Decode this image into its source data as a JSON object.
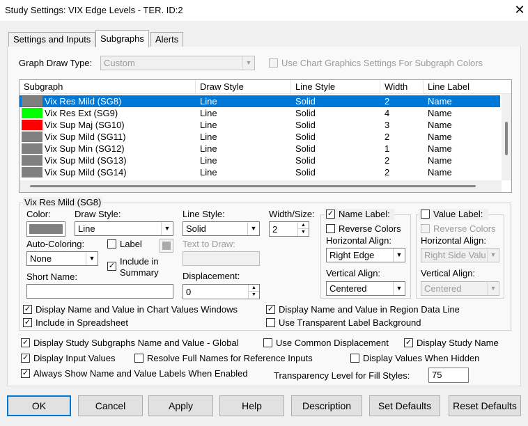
{
  "window": {
    "title": "Study Settings: VIX Edge Levels - TER. ID:2",
    "close_glyph": "✕"
  },
  "tabs": [
    {
      "label": "Settings and Inputs"
    },
    {
      "label": "Subgraphs"
    },
    {
      "label": "Alerts"
    }
  ],
  "graph_draw_type": {
    "label": "Graph Draw Type:",
    "value": "Custom"
  },
  "use_chart_graphics": {
    "label": "Use Chart Graphics Settings For Subgraph Colors",
    "checked": false
  },
  "subgraph_list": {
    "columns": [
      "Subgraph",
      "Draw Style",
      "Line Style",
      "Width",
      "Line Label"
    ],
    "rows": [
      {
        "name": "Vix Res Mild (SG8)",
        "draw_style": "Line",
        "line_style": "Solid",
        "width": "2",
        "line_label": "Name",
        "color": "#7f7f7f",
        "selected": true
      },
      {
        "name": "Vix Res Ext (SG9)",
        "draw_style": "Line",
        "line_style": "Solid",
        "width": "4",
        "line_label": "Name",
        "color": "#00ff00"
      },
      {
        "name": "Vix Sup Maj (SG10)",
        "draw_style": "Line",
        "line_style": "Solid",
        "width": "3",
        "line_label": "Name",
        "color": "#ff0000"
      },
      {
        "name": "Vix Sup Mild (SG11)",
        "draw_style": "Line",
        "line_style": "Solid",
        "width": "2",
        "line_label": "Name",
        "color": "#808080"
      },
      {
        "name": "Vix Sup Min (SG12)",
        "draw_style": "Line",
        "line_style": "Solid",
        "width": "1",
        "line_label": "Name",
        "color": "#808080"
      },
      {
        "name": "Vix Sup Mild (SG13)",
        "draw_style": "Line",
        "line_style": "Solid",
        "width": "2",
        "line_label": "Name",
        "color": "#808080"
      },
      {
        "name": "Vix Sup Mild (SG14)",
        "draw_style": "Line",
        "line_style": "Solid",
        "width": "2",
        "line_label": "Name",
        "color": "#808080"
      }
    ]
  },
  "detail": {
    "group_title": "Vix Res Mild (SG8)",
    "color_label": "Color:",
    "color_value": "#808080",
    "draw_style_label": "Draw Style:",
    "draw_style_value": "Line",
    "line_style_label": "Line Style:",
    "line_style_value": "Solid",
    "width_label": "Width/Size:",
    "width_value": "2",
    "auto_coloring_label": "Auto-Coloring:",
    "auto_coloring_value": "None",
    "label_checkbox": "Label",
    "include_summary_label": "Include in Summary",
    "text_to_draw_label": "Text to Draw:",
    "short_name_label": "Short Name:",
    "short_name_value": "",
    "displacement_label": "Displacement:",
    "displacement_value": "0",
    "name_label": {
      "label": "Name Label:",
      "checked": true
    },
    "name_reverse_colors": "Reverse Colors",
    "name_h_align_label": "Horizontal Align:",
    "name_h_align_value": "Right Edge",
    "name_v_align_label": "Vertical Align:",
    "name_v_align_value": "Centered",
    "value_label": {
      "label": "Value Label:",
      "checked": false
    },
    "value_reverse_colors": "Reverse Colors",
    "value_h_align_label": "Horizontal Align:",
    "value_h_align_value": "Right Side Valu",
    "value_v_align_label": "Vertical Align:",
    "value_v_align_value": "Centered",
    "display_name_value_chart": "Display Name and Value in Chart Values Windows",
    "include_spreadsheet": "Include in Spreadsheet",
    "display_name_value_region": "Display Name and Value in Region Data Line",
    "transparent_label_bg": "Use Transparent Label Background"
  },
  "global": {
    "display_subgraphs_global": "Display Study Subgraphs Name and Value - Global",
    "use_common_displacement": "Use Common Displacement",
    "display_study_name": "Display Study Name",
    "display_input_values": "Display Input Values",
    "resolve_full_names": "Resolve Full Names for Reference Inputs",
    "display_values_hidden": "Display Values When Hidden",
    "always_show_labels": "Always Show Name and Value Labels When Enabled",
    "transparency_label": "Transparency Level for Fill Styles:",
    "transparency_value": "75"
  },
  "buttons": {
    "ok": "OK",
    "cancel": "Cancel",
    "apply": "Apply",
    "help": "Help",
    "description": "Description",
    "set_defaults": "Set Defaults",
    "reset_defaults": "Reset Defaults"
  },
  "glyphs": {
    "check": "✓",
    "down": "▼",
    "up": "▲"
  }
}
